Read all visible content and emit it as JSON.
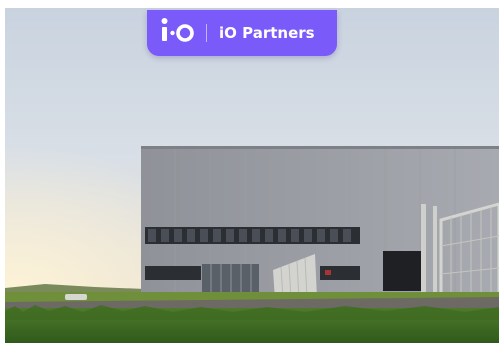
{
  "brand": {
    "name": "iO Partners",
    "logo_icon": "io-logo-icon",
    "accent_color": "#7a5af8"
  },
  "photo": {
    "scene_icon": "warehouse-photo"
  }
}
